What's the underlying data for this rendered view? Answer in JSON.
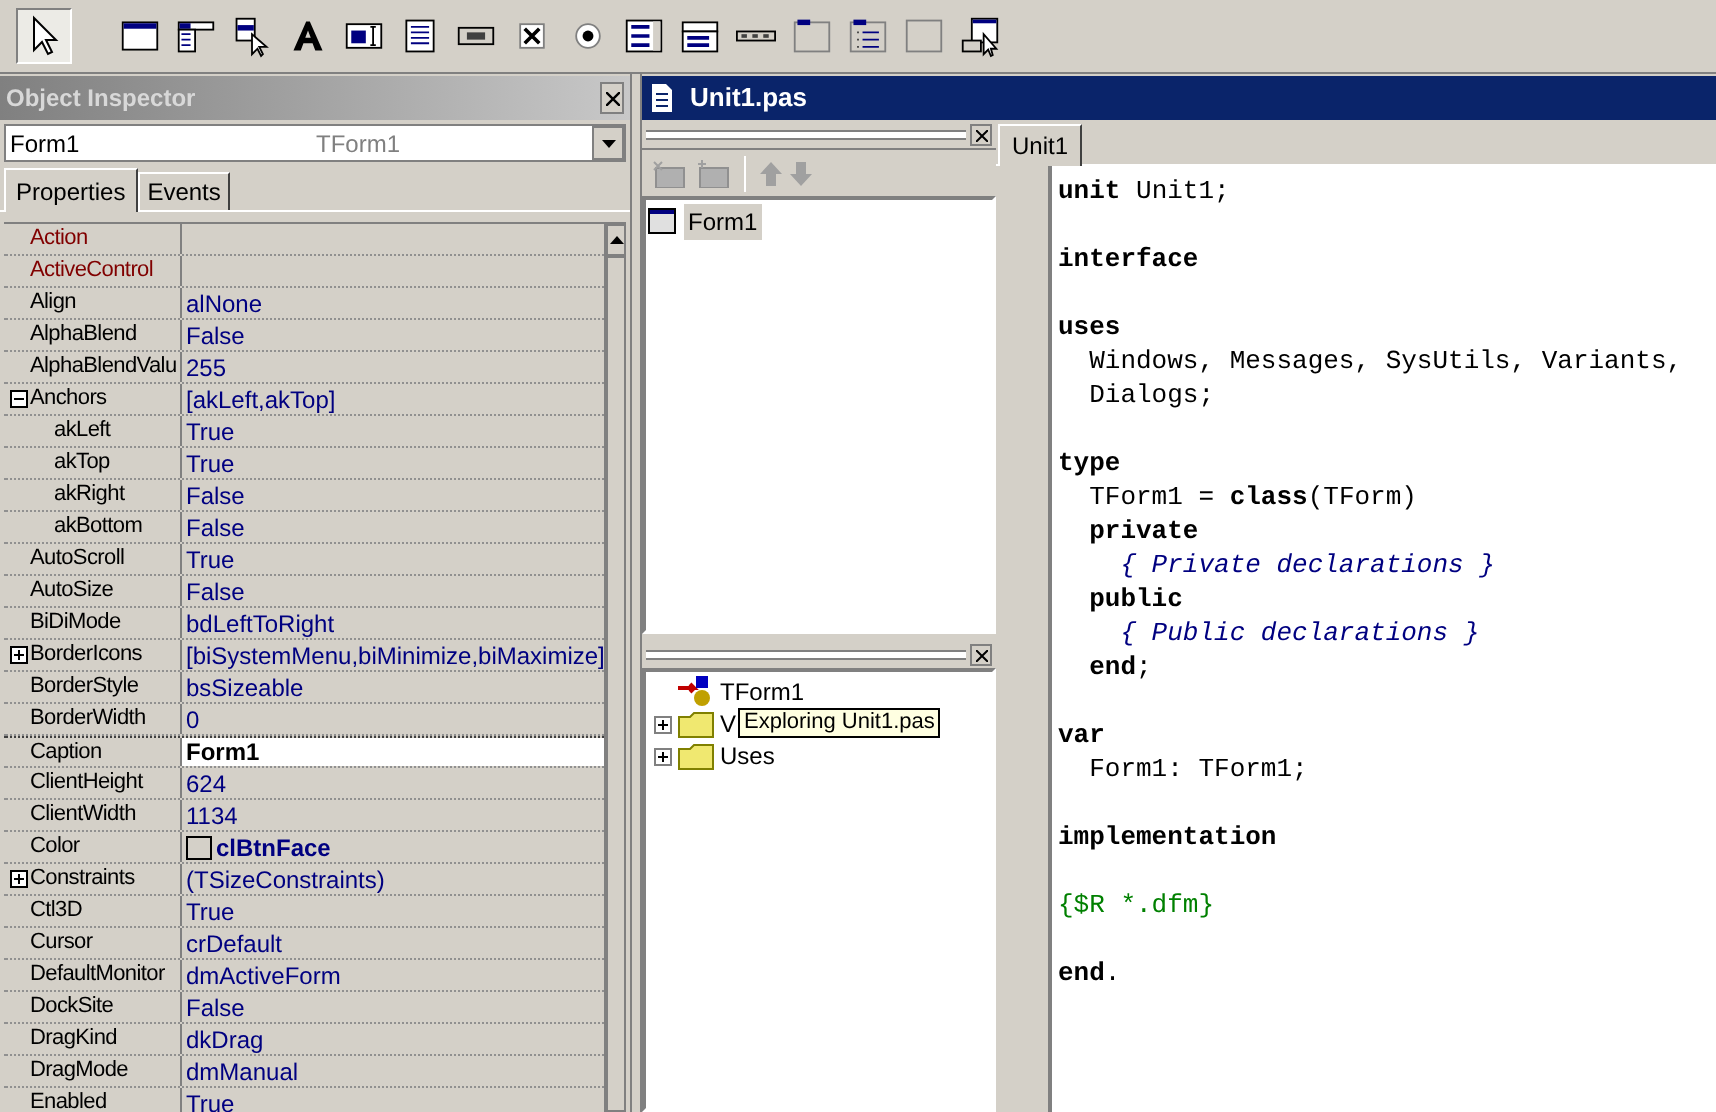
{
  "palette": [
    {
      "kind": "pointer",
      "selected": true
    },
    {
      "kind": "frame",
      "selected": false
    },
    {
      "kind": "mainmenu",
      "selected": false
    },
    {
      "kind": "popupmenu",
      "selected": false
    },
    {
      "kind": "label",
      "selected": false
    },
    {
      "kind": "edit",
      "selected": false
    },
    {
      "kind": "memo",
      "selected": false
    },
    {
      "kind": "button",
      "selected": false
    },
    {
      "kind": "checkbox",
      "selected": false
    },
    {
      "kind": "radio",
      "selected": false
    },
    {
      "kind": "listbox",
      "selected": false
    },
    {
      "kind": "combobox",
      "selected": false
    },
    {
      "kind": "scrollbar",
      "selected": false
    },
    {
      "kind": "groupbox",
      "selected": false
    },
    {
      "kind": "radiogroup",
      "selected": false
    },
    {
      "kind": "panel",
      "selected": false
    },
    {
      "kind": "actionlist",
      "selected": false
    }
  ],
  "object_inspector": {
    "title": "Object Inspector",
    "object_name": "Form1",
    "object_type": "TForm1",
    "tabs": [
      {
        "label": "Properties",
        "selected": true
      },
      {
        "label": "Events",
        "selected": false
      }
    ],
    "properties": [
      {
        "name": "Action",
        "kind": "reference",
        "selected": false
      },
      {
        "name": "ActiveControl",
        "kind": "reference",
        "selected": false
      },
      {
        "name": "Align",
        "value": "alNone",
        "kind": "plain",
        "selected": false
      },
      {
        "name": "AlphaBlend",
        "value": "False",
        "kind": "plain",
        "selected": false
      },
      {
        "name": "AlphaBlendValu",
        "value": "255",
        "kind": "plain",
        "selected": false
      },
      {
        "name": "Anchors",
        "value": "[akLeft,akTop]",
        "kind": "plain",
        "selected": false,
        "expanded": true,
        "children": [
          {
            "name": "akLeft",
            "value": "True",
            "kind": "plain",
            "selected": false
          },
          {
            "name": "akTop",
            "value": "True",
            "kind": "plain",
            "selected": false
          },
          {
            "name": "akRight",
            "value": "False",
            "kind": "plain",
            "selected": false
          },
          {
            "name": "akBottom",
            "value": "False",
            "kind": "plain",
            "selected": false
          }
        ]
      },
      {
        "name": "AutoScroll",
        "value": "True",
        "kind": "plain",
        "selected": false
      },
      {
        "name": "AutoSize",
        "value": "False",
        "kind": "plain",
        "selected": false
      },
      {
        "name": "BiDiMode",
        "value": "bdLeftToRight",
        "kind": "plain",
        "selected": false
      },
      {
        "name": "BorderIcons",
        "value": "[biSystemMenu,biMinimize,biMaximize]",
        "kind": "plain",
        "selected": false,
        "expanded": false
      },
      {
        "name": "BorderStyle",
        "value": "bsSizeable",
        "kind": "plain",
        "selected": false
      },
      {
        "name": "BorderWidth",
        "value": "0",
        "kind": "plain",
        "selected": false
      },
      {
        "name": "Caption",
        "value": "Form1",
        "kind": "plain",
        "selected": true
      },
      {
        "name": "ClientHeight",
        "value": "624",
        "kind": "plain",
        "selected": false
      },
      {
        "name": "ClientWidth",
        "value": "1134",
        "kind": "plain",
        "selected": false
      },
      {
        "name": "Color",
        "value": "clBtnFace",
        "kind": "color",
        "selected": false
      },
      {
        "name": "Constraints",
        "value": "(TSizeConstraints)",
        "kind": "plain",
        "selected": false,
        "expanded": false
      },
      {
        "name": "Ctl3D",
        "value": "True",
        "kind": "plain",
        "selected": false
      },
      {
        "name": "Cursor",
        "value": "crDefault",
        "kind": "plain",
        "selected": false
      },
      {
        "name": "DefaultMonitor",
        "value": "dmActiveForm",
        "kind": "plain",
        "selected": false
      },
      {
        "name": "DockSite",
        "value": "False",
        "kind": "plain",
        "selected": false
      },
      {
        "name": "DragKind",
        "value": "dkDrag",
        "kind": "plain",
        "selected": false
      },
      {
        "name": "DragMode",
        "value": "dmManual",
        "kind": "plain",
        "selected": false
      },
      {
        "name": "Enabled",
        "value": "True",
        "kind": "plain",
        "selected": false
      }
    ]
  },
  "editor": {
    "title": "Unit1.pas",
    "explorer_tree": [
      {
        "label": "Form1",
        "kind": "form",
        "selected": true
      }
    ],
    "explorer_classes": [
      {
        "label": "TForm1",
        "kind": "class"
      },
      {
        "label": "V",
        "kind": "folder",
        "expanded": false
      },
      {
        "label": "Uses",
        "kind": "folder",
        "expanded": false
      }
    ],
    "tooltip": "Exploring Unit1.pas",
    "tabs": [
      {
        "label": "Unit1",
        "selected": true
      }
    ],
    "code": [
      {
        "kind": "code",
        "segments": [
          {
            "kind": "keyword",
            "text": "unit"
          },
          {
            "kind": "plain",
            "text": " Unit1;"
          }
        ]
      },
      {
        "kind": "blank"
      },
      {
        "kind": "code",
        "segments": [
          {
            "kind": "keyword",
            "text": "interface"
          }
        ]
      },
      {
        "kind": "blank"
      },
      {
        "kind": "code",
        "segments": [
          {
            "kind": "keyword",
            "text": "uses"
          }
        ]
      },
      {
        "kind": "code",
        "segments": [
          {
            "kind": "plain",
            "text": "  Windows, Messages, SysUtils, Variants,"
          }
        ]
      },
      {
        "kind": "code",
        "segments": [
          {
            "kind": "plain",
            "text": "  Dialogs;"
          }
        ]
      },
      {
        "kind": "blank"
      },
      {
        "kind": "code",
        "segments": [
          {
            "kind": "keyword",
            "text": "type"
          }
        ]
      },
      {
        "kind": "code",
        "segments": [
          {
            "kind": "plain",
            "text": "  TForm1 = "
          },
          {
            "kind": "keyword",
            "text": "class"
          },
          {
            "kind": "plain",
            "text": "(TForm)"
          }
        ]
      },
      {
        "kind": "code",
        "segments": [
          {
            "kind": "keyword",
            "text": "  private"
          }
        ]
      },
      {
        "kind": "code",
        "segments": [
          {
            "kind": "comment",
            "text": "    { Private declarations }"
          }
        ]
      },
      {
        "kind": "code",
        "segments": [
          {
            "kind": "keyword",
            "text": "  public"
          }
        ]
      },
      {
        "kind": "code",
        "segments": [
          {
            "kind": "comment",
            "text": "    { Public declarations }"
          }
        ]
      },
      {
        "kind": "code",
        "segments": [
          {
            "kind": "keyword",
            "text": "  end"
          },
          {
            "kind": "plain",
            "text": ";"
          }
        ]
      },
      {
        "kind": "blank"
      },
      {
        "kind": "code",
        "segments": [
          {
            "kind": "keyword",
            "text": "var"
          }
        ]
      },
      {
        "kind": "code",
        "segments": [
          {
            "kind": "plain",
            "text": "  Form1: TForm1;"
          }
        ]
      },
      {
        "kind": "blank"
      },
      {
        "kind": "code",
        "segments": [
          {
            "kind": "keyword",
            "text": "implementation"
          }
        ]
      },
      {
        "kind": "blank"
      },
      {
        "kind": "code",
        "segments": [
          {
            "kind": "directive",
            "text": "{$R *.dfm}"
          }
        ]
      },
      {
        "kind": "blank"
      },
      {
        "kind": "code",
        "segments": [
          {
            "kind": "keyword",
            "text": "end"
          },
          {
            "kind": "plain",
            "text": "."
          }
        ]
      }
    ]
  }
}
